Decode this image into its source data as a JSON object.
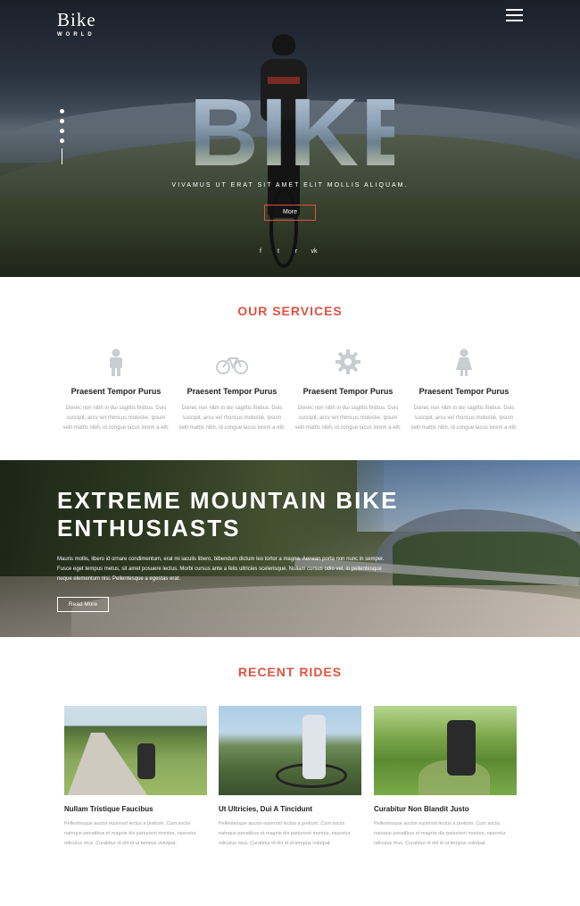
{
  "brand": {
    "name": "Bike",
    "sub": "WORLD"
  },
  "hero": {
    "big_word": "BIKE",
    "tagline": "VIVAMUS UT ERAT SIT AMET ELIT MOLLIS ALIQUAM.",
    "more_label": "More",
    "social_icons": [
      "facebook-icon",
      "twitter-icon",
      "rss-icon",
      "vk-icon"
    ],
    "social_glyphs": [
      "f",
      "t",
      "r",
      "vk"
    ]
  },
  "services": {
    "title": "OUR SERVICES",
    "items": [
      {
        "icon": "person-icon",
        "title": "Praesent Tempor Purus",
        "desc": "Donec non nibh in dui sagittis finibus. Duis suscipit, arcu vel rhoncus molestie, ipsum velit mattis nibh, id congue lacus lorem a elit."
      },
      {
        "icon": "bicycle-icon",
        "title": "Praesent Tempor Purus",
        "desc": "Donec non nibh in dui sagittis finibus. Duis suscipit, arcu vel rhoncus molestie, ipsum velit mattis nibh, id congue lacus lorem a elit."
      },
      {
        "icon": "gear-icon",
        "title": "Praesent Tempor Purus",
        "desc": "Donec non nibh in dui sagittis finibus. Duis suscipit, arcu vel rhoncus molestie, ipsum velit mattis nibh, id congue lacus lorem a elit."
      },
      {
        "icon": "woman-icon",
        "title": "Praesent Tempor Purus",
        "desc": "Donec non nibh in dui sagittis finibus. Duis suscipit, arcu vel rhoncus molestie, ipsum velit mattis nibh, id congue lacus lorem a elit."
      }
    ]
  },
  "banner": {
    "heading": "EXTREME MOUNTAIN BIKE ENTHUSIASTS",
    "text": "Mauris mollis, libero id ornare condimentum, erat mi iaculis libero, bibendum dictum leo tortor a magna. Aenean porta non nunc in semper. Fusce eget tempus metus, sit amet posuere lectus. Morbi cursus ante a felis ultricies scelerisque. Nullam cursus odio vel, in pellentesque neque elementum nisi. Pellentesque a egestas erat.",
    "read_more_label": "Read More"
  },
  "rides": {
    "title": "RECENT RIDES",
    "items": [
      {
        "title": "Nullam Tristique Faucibus",
        "desc": "Pellentesque auctor euismod lectus a pretium. Cum sociis natoque penatibus et magnis dis parturient montes, nascetur ridiculus mus. Curabitur id elit id ut tempus volutpat."
      },
      {
        "title": "Ut Ultricies, Dui A Tincidunt",
        "desc": "Pellentesque auctor euismod lectus a pretium. Cum sociis natoque penatibus et magnis dis parturient montes, nascetur ridiculus mus. Curabitur id elit id ut tempus volutpat."
      },
      {
        "title": "Curabitur Non Blandit Justo",
        "desc": "Pellentesque auctor euismod lectus a pretium. Cum sociis natoque penatibus et magnis dis parturient montes, nascetur ridiculus mus. Curabitur id elit id ut tempus volutpat."
      }
    ]
  },
  "colors": {
    "accent": "#e0523f",
    "icon_gray": "#c9ccd1",
    "text_muted": "#a0a0a0"
  }
}
